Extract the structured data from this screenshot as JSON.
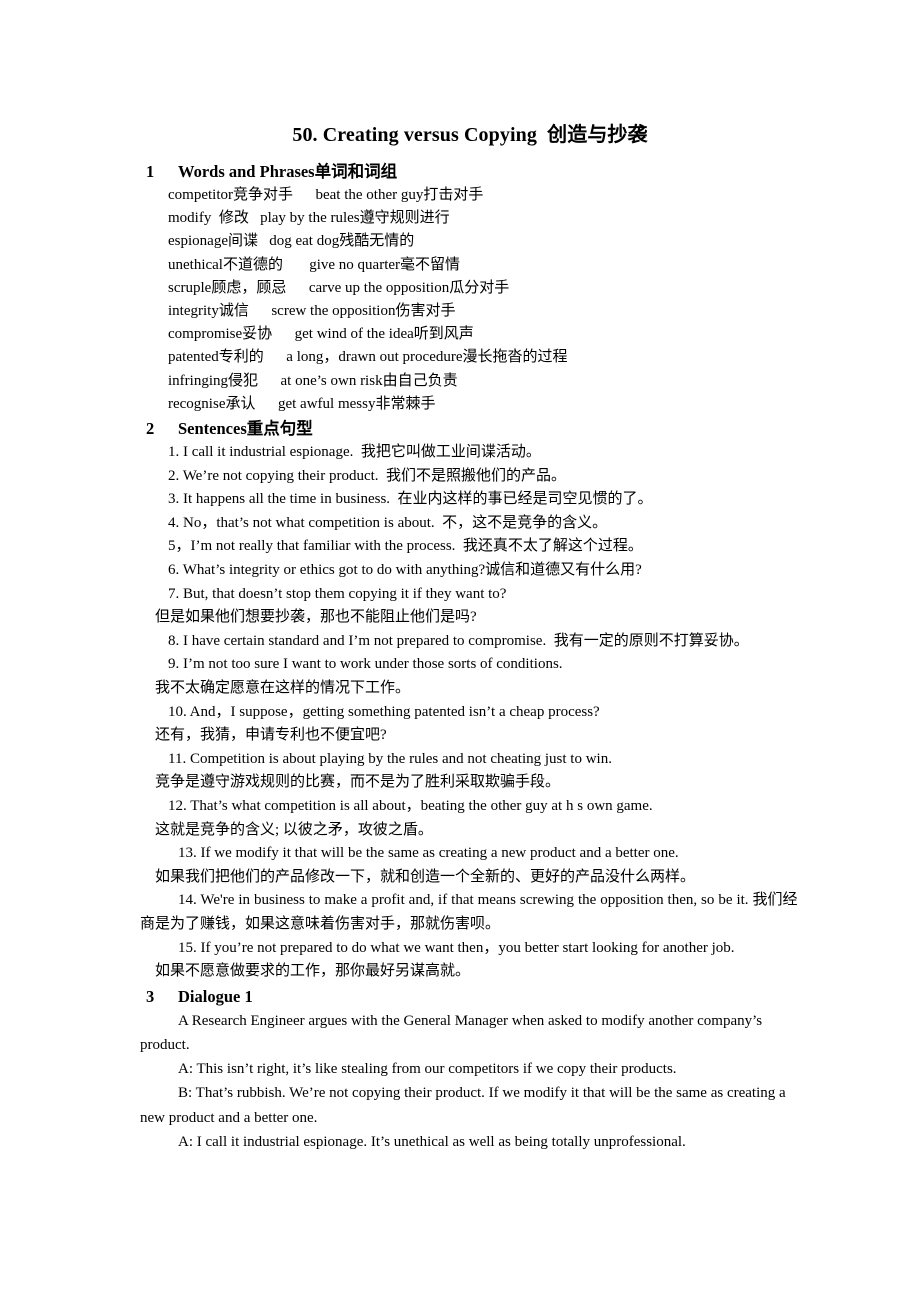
{
  "document": {
    "title": "50. Creating versus Copying  创造与抄袭"
  },
  "sections": [
    {
      "number": "1",
      "heading": "Words and Phrases单词和词组"
    },
    {
      "number": "2",
      "heading": "Sentences重点句型"
    },
    {
      "number": "3",
      "heading": "Dialogue 1"
    }
  ],
  "vocabulary": [
    "competitor竞争对手      beat the other guy打击对手",
    "modify  修改   play by the rules遵守规则进行",
    "espionage间谍   dog eat dog残酷无情的",
    "unethical不道德的       give no quarter毫不留情",
    "scruple顾虑，顾忌      carve up the opposition瓜分对手",
    "integrity诚信      screw the opposition伤害对手",
    "compromise妥协      get wind of the idea听到风声",
    "patented专利的      a long，drawn out procedure漫长拖沓的过程",
    "infringing侵犯      at one’s own risk由自己负责",
    "recognise承认      get awful messy非常棘手"
  ],
  "sentences": [
    {
      "en": "1. I call it industrial espionage.  我把它叫做工业间谍活动。"
    },
    {
      "en": "2. We’re not copying their product.  我们不是照搬他们的产品。"
    },
    {
      "en": "3. It happens all the time in business.  在业内这样的事已经是司空见惯的了。"
    },
    {
      "en": "4. No，that’s not what competition is about.  不，这不是竞争的含义。"
    },
    {
      "en": "5，I’m not really that familiar with the process.  我还真不太了解这个过程。"
    },
    {
      "en": "6. What’s integrity or ethics got to do with anything?诚信和道德又有什么用?"
    },
    {
      "en": "7. But, that doesn’t stop them copying it if they want to?",
      "cn": "但是如果他们想要抄袭，那也不能阻止他们是吗?"
    },
    {
      "en": "8. I have certain standard and I’m not prepared to compromise.  我有一定的原则不打算妥协。"
    },
    {
      "en": "9. I’m not too sure I want to work under those sorts of conditions.",
      "cn": "我不太确定愿意在这样的情况下工作。"
    },
    {
      "en": "10. And，I suppose，getting something patented isn’t a cheap process?",
      "cn": "还有，我猜，申请专利也不便宜吧?"
    },
    {
      "en": "11. Competition is about playing by the rules and not cheating just to win.",
      "cn": "竞争是遵守游戏规则的比赛，而不是为了胜利采取欺骗手段。"
    },
    {
      "en": "12. That’s what competition is all about，beating the other guy at h s own game.",
      "cn": "这就是竞争的含义; 以彼之矛，攻彼之盾。"
    },
    {
      "en": "13. If we modify it that will be the same as creating a new product and a better one.",
      "cn": "如果我们把他们的产品修改一下，就和创造一个全新的、更好的产品没什么两样。"
    },
    {
      "en": "14. We're in business to make a profit and, if that means screwing the opposition then, so be it.  我们经商是为了赚钱，如果这意味着伤害对手，那就伤害呗。"
    },
    {
      "en": "15. If you’re not prepared to do what we want then，you better start looking for another job.",
      "cn": "如果不愿意做要求的工作，那你最好另谋高就。"
    }
  ],
  "dialogue": [
    "A Research Engineer argues with the General Manager when asked to modify another company’s product.",
    "A: This isn’t right, it’s like stealing from our competitors if we copy their products.",
    "B: That’s rubbish. We’re not copying their product. If we modify it that will be the same as creating a new product and a better one.",
    "A: I call it industrial espionage. It’s unethical as well as being totally unprofessional."
  ]
}
